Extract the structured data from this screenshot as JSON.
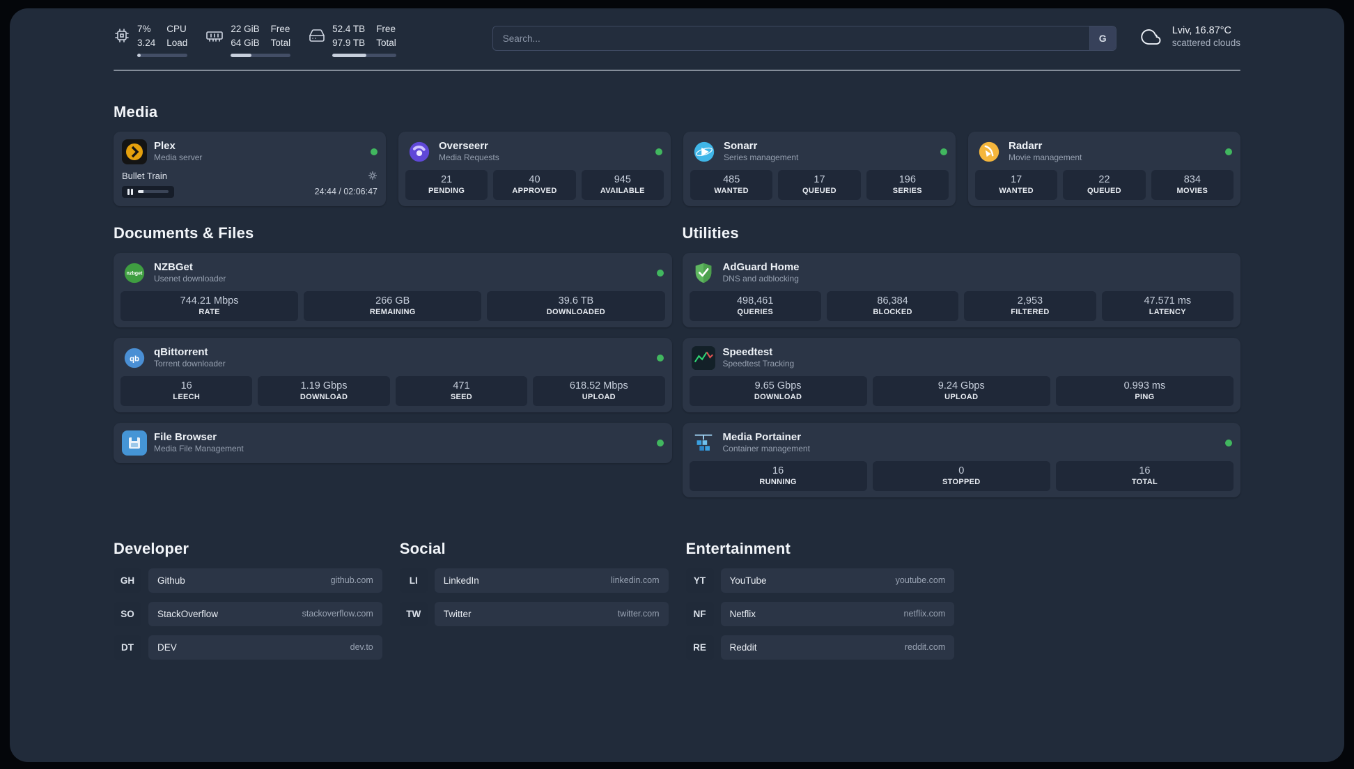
{
  "topbar": {
    "resources": [
      {
        "widget": "cpu",
        "values": [
          "7%",
          "3.24"
        ],
        "labels": [
          "CPU",
          "Load"
        ],
        "progress": 7
      },
      {
        "widget": "memory",
        "values": [
          "22 GiB",
          "64 GiB"
        ],
        "labels": [
          "Free",
          "Total"
        ],
        "progress": 34
      },
      {
        "widget": "disk",
        "values": [
          "52.4 TB",
          "97.9 TB"
        ],
        "labels": [
          "Free",
          "Total"
        ],
        "progress": 53
      }
    ],
    "search": {
      "placeholder": "Search...",
      "provider": "G"
    },
    "weather": {
      "location": "Lviv, 16.87°C",
      "condition": "scattered clouds"
    }
  },
  "icons": {
    "cpu": "cpu-chip-icon",
    "memory": "ram-icon",
    "disk": "hard-drive-icon",
    "weather": "cloud-icon",
    "player_settings": "gear-icon",
    "player_state": "pause-icon",
    "status": "green-status-dot"
  },
  "groups": {
    "media": {
      "title": "Media",
      "services": [
        {
          "name": "Plex",
          "subtitle": "Media server",
          "icon": "plex-icon",
          "status": "online",
          "player": {
            "title": "Bullet Train",
            "time": "24:44 / 02:06:47",
            "progress": 20,
            "state": "paused"
          }
        },
        {
          "name": "Overseerr",
          "subtitle": "Media Requests",
          "icon": "overseerr-icon",
          "status": "online",
          "stats": [
            {
              "value": "21",
              "label": "PENDING"
            },
            {
              "value": "40",
              "label": "APPROVED"
            },
            {
              "value": "945",
              "label": "AVAILABLE"
            }
          ]
        },
        {
          "name": "Sonarr",
          "subtitle": "Series management",
          "icon": "sonarr-icon",
          "status": "online",
          "stats": [
            {
              "value": "485",
              "label": "WANTED"
            },
            {
              "value": "17",
              "label": "QUEUED"
            },
            {
              "value": "196",
              "label": "SERIES"
            }
          ]
        },
        {
          "name": "Radarr",
          "subtitle": "Movie management",
          "icon": "radarr-icon",
          "status": "online",
          "stats": [
            {
              "value": "17",
              "label": "WANTED"
            },
            {
              "value": "22",
              "label": "QUEUED"
            },
            {
              "value": "834",
              "label": "MOVIES"
            }
          ]
        }
      ]
    },
    "documents": {
      "title": "Documents & Files",
      "services": [
        {
          "name": "NZBGet",
          "subtitle": "Usenet downloader",
          "icon": "nzbget-icon",
          "status": "online",
          "stats": [
            {
              "value": "744.21 Mbps",
              "label": "RATE"
            },
            {
              "value": "266 GB",
              "label": "REMAINING"
            },
            {
              "value": "39.6 TB",
              "label": "DOWNLOADED"
            }
          ]
        },
        {
          "name": "qBittorrent",
          "subtitle": "Torrent downloader",
          "icon": "qbittorrent-icon",
          "status": "online",
          "stats": [
            {
              "value": "16",
              "label": "LEECH"
            },
            {
              "value": "1.19 Gbps",
              "label": "DOWNLOAD"
            },
            {
              "value": "471",
              "label": "SEED"
            },
            {
              "value": "618.52 Mbps",
              "label": "UPLOAD"
            }
          ]
        },
        {
          "name": "File Browser",
          "subtitle": "Media File Management",
          "icon": "filebrowser-icon",
          "status": "online",
          "stats": []
        }
      ]
    },
    "utilities": {
      "title": "Utilities",
      "services": [
        {
          "name": "AdGuard Home",
          "subtitle": "DNS and adblocking",
          "icon": "adguard-icon",
          "stats": [
            {
              "value": "498,461",
              "label": "QUERIES"
            },
            {
              "value": "86,384",
              "label": "BLOCKED"
            },
            {
              "value": "2,953",
              "label": "FILTERED"
            },
            {
              "value": "47.571 ms",
              "label": "LATENCY"
            }
          ]
        },
        {
          "name": "Speedtest",
          "subtitle": "Speedtest Tracking",
          "icon": "speedtest-icon",
          "stats": [
            {
              "value": "9.65 Gbps",
              "label": "DOWNLOAD"
            },
            {
              "value": "9.24 Gbps",
              "label": "UPLOAD"
            },
            {
              "value": "0.993 ms",
              "label": "PING"
            }
          ]
        },
        {
          "name": "Media Portainer",
          "subtitle": "Container management",
          "icon": "portainer-icon",
          "status": "online",
          "stats": [
            {
              "value": "16",
              "label": "RUNNING"
            },
            {
              "value": "0",
              "label": "STOPPED"
            },
            {
              "value": "16",
              "label": "TOTAL"
            }
          ]
        }
      ]
    }
  },
  "bookmarks": [
    {
      "title": "Developer",
      "items": [
        {
          "abbr": "GH",
          "name": "Github",
          "url": "github.com"
        },
        {
          "abbr": "SO",
          "name": "StackOverflow",
          "url": "stackoverflow.com"
        },
        {
          "abbr": "DT",
          "name": "DEV",
          "url": "dev.to"
        }
      ]
    },
    {
      "title": "Social",
      "items": [
        {
          "abbr": "LI",
          "name": "LinkedIn",
          "url": "linkedin.com"
        },
        {
          "abbr": "TW",
          "name": "Twitter",
          "url": "twitter.com"
        }
      ]
    },
    {
      "title": "Entertainment",
      "items": [
        {
          "abbr": "YT",
          "name": "YouTube",
          "url": "youtube.com"
        },
        {
          "abbr": "NF",
          "name": "Netflix",
          "url": "netflix.com"
        },
        {
          "abbr": "RE",
          "name": "Reddit",
          "url": "reddit.com"
        }
      ]
    }
  ]
}
